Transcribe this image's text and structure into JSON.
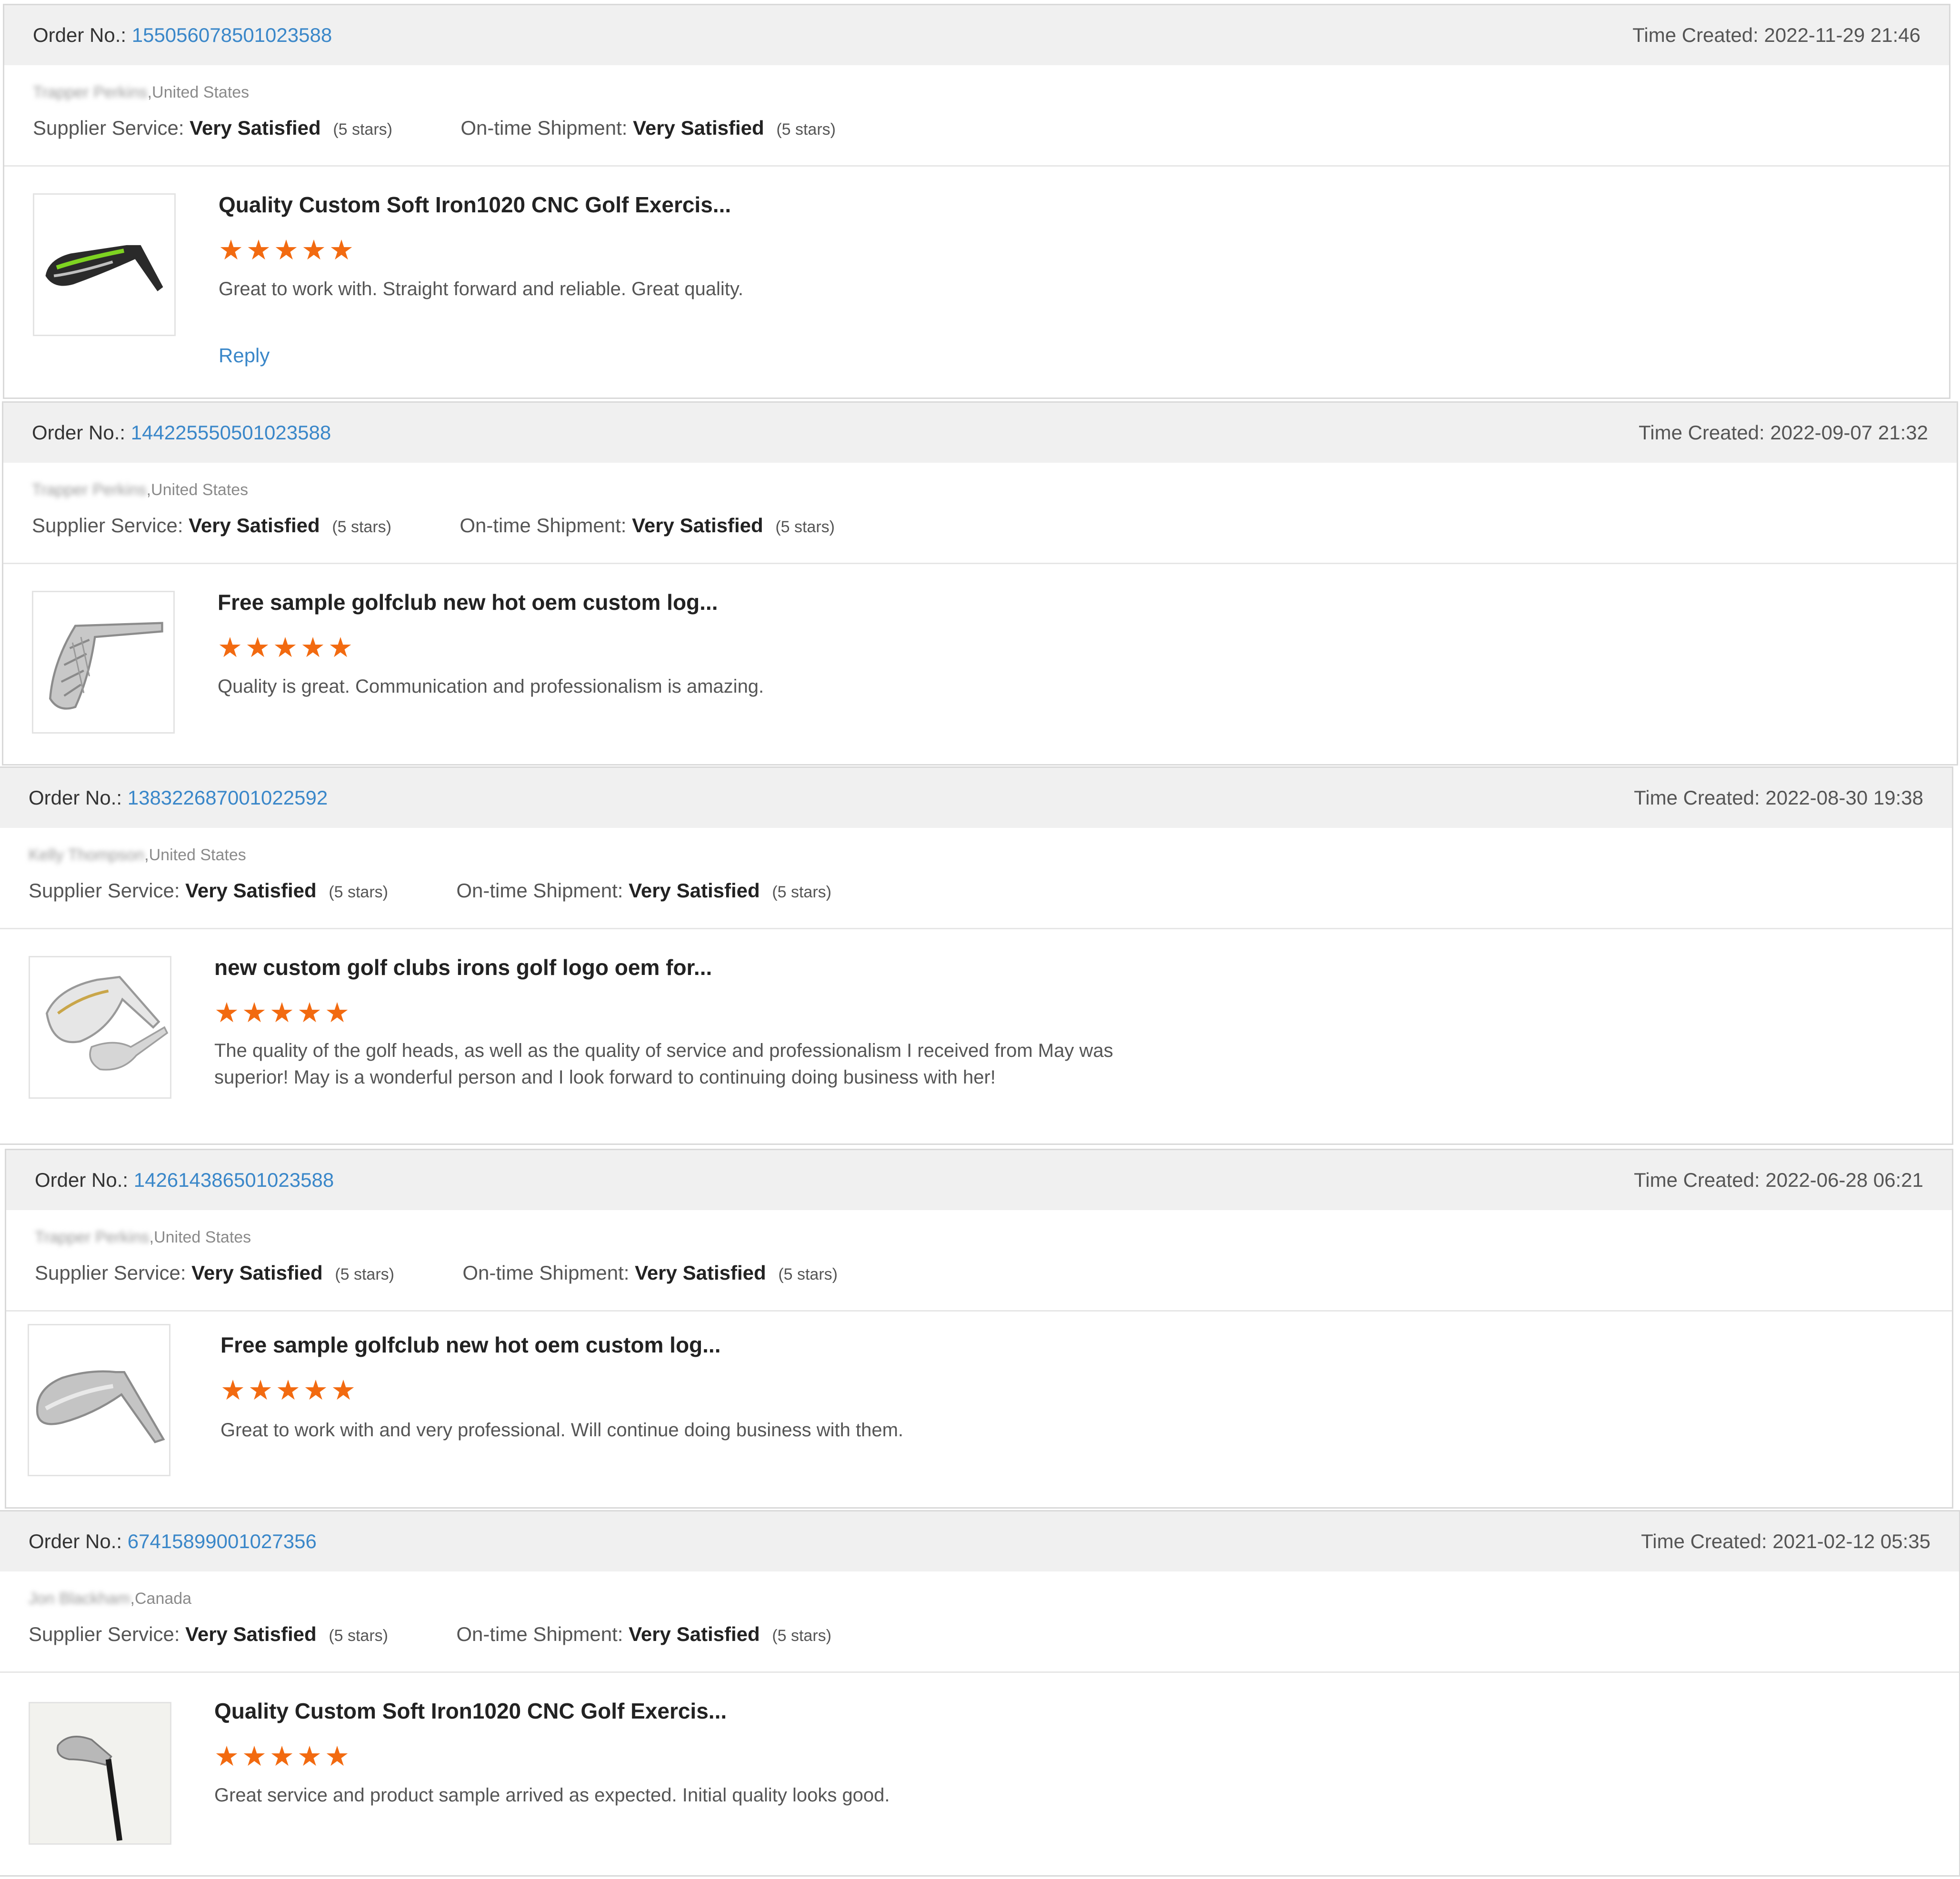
{
  "labels": {
    "order_no": "Order No.:",
    "time_created": "Time Created:",
    "supplier_service": "Supplier Service:",
    "ontime_shipment": "On-time Shipment:",
    "reply": "Reply"
  },
  "star_color": "#f26a10",
  "link_color": "#3a87c9",
  "orders": [
    {
      "order_no": "155056078501023588",
      "time_created": "2022-11-29 21:46",
      "buyer_name": "Trapper Perkins",
      "buyer_country": ",United States",
      "supplier_service": "Very Satisfied",
      "supplier_stars_text": "(5 stars)",
      "shipment": "Very Satisfied",
      "shipment_stars_text": "(5 stars)",
      "product_title": "Quality Custom Soft Iron1020 CNC Golf Exercis...",
      "rating": 5,
      "stars": "★★★★★",
      "review": "Great to work with.  Straight forward and reliable.  Great quality.",
      "has_reply_link": true,
      "product_icon": "golf-iron-green-icon"
    },
    {
      "order_no": "144225550501023588",
      "time_created": "2022-09-07 21:32",
      "buyer_name": "Trapper Perkins",
      "buyer_country": ",United States",
      "supplier_service": "Very Satisfied",
      "supplier_stars_text": "(5 stars)",
      "shipment": "Very Satisfied",
      "shipment_stars_text": "(5 stars)",
      "product_title": "Free sample golfclub new hot oem custom log...",
      "rating": 5,
      "stars": "★★★★★",
      "review": "Quality is great.  Communication and professionalism is amazing.",
      "has_reply_link": false,
      "product_icon": "golf-iron-chrome-icon"
    },
    {
      "order_no": "138322687001022592",
      "time_created": "2022-08-30 19:38",
      "buyer_name": "Kelly Thompson",
      "buyer_country": ",United States",
      "supplier_service": "Very Satisfied",
      "supplier_stars_text": "(5 stars)",
      "shipment": "Very Satisfied",
      "shipment_stars_text": "(5 stars)",
      "product_title": "new custom golf clubs irons golf logo oem for...",
      "rating": 5,
      "stars": "★★★★★",
      "review": "The quality of the golf heads, as well as the quality of service and professionalism I received from May was superior!  May is a wonderful person and I look forward to continuing doing business with her!",
      "has_reply_link": false,
      "product_icon": "golf-wedge-icon"
    },
    {
      "order_no": "142614386501023588",
      "time_created": "2022-06-28 06:21",
      "buyer_name": "Trapper Perkins",
      "buyer_country": ",United States",
      "supplier_service": "Very Satisfied",
      "supplier_stars_text": "(5 stars)",
      "shipment": "Very Satisfied",
      "shipment_stars_text": "(5 stars)",
      "product_title": "Free sample golfclub new hot oem custom log...",
      "rating": 5,
      "stars": "★★★★★",
      "review": "Great to work with and very professional.  Will continue doing business with them.",
      "has_reply_link": false,
      "product_icon": "golf-iron-silver-icon"
    },
    {
      "order_no": "67415899001027356",
      "time_created": "2021-02-12 05:35",
      "buyer_name": "Jon Blackham",
      "buyer_country": ",Canada",
      "supplier_service": "Very Satisfied",
      "supplier_stars_text": "(5 stars)",
      "shipment": "Very Satisfied",
      "shipment_stars_text": "(5 stars)",
      "product_title": "Quality Custom Soft Iron1020 CNC Golf Exercis...",
      "rating": 5,
      "stars": "★★★★★",
      "review": "Great service and product sample arrived as expected. Initial quality looks good.",
      "has_reply_link": false,
      "product_icon": "golf-club-shaft-icon"
    }
  ]
}
